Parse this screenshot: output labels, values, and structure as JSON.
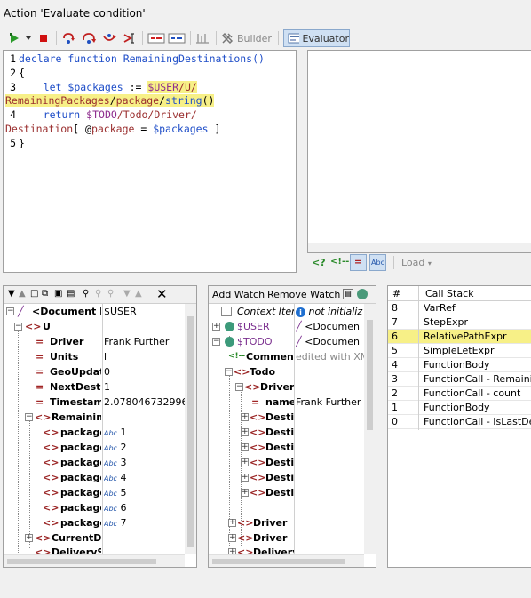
{
  "window": {
    "title": "Action 'Evaluate condition'"
  },
  "toolbar": {
    "builder_label": "Builder",
    "evaluator_label": "Evaluator",
    "icons": [
      "run-icon",
      "dropdown-arrow-icon",
      "stop-icon",
      "step-into-icon",
      "step-over-icon",
      "step-out-icon",
      "breakpoint-icon",
      "toggle-breakpoint-icon",
      "toggle-tracepoint-icon",
      "clear-icon",
      "builder-icon",
      "evaluator-icon"
    ]
  },
  "editor": {
    "lines": [
      {
        "num": "1",
        "text": "declare function RemainingDestinations()"
      },
      {
        "num": "2",
        "text": "{"
      },
      {
        "num": "3",
        "text": "    let $packages := $USER/U/"
      },
      {
        "num": "",
        "text": "RemainingPackages/package/string()"
      },
      {
        "num": "4",
        "text": "    return $TODO/Todo/Driver/"
      },
      {
        "num": "",
        "text": "Destination[ @package = $packages ]"
      },
      {
        "num": "5",
        "text": "}"
      }
    ]
  },
  "result_toolbar": {
    "load_label": "Load"
  },
  "xml_tree": {
    "rows": [
      {
        "label": "<Document Ro",
        "value": "$USER"
      },
      {
        "label": "U",
        "value": ""
      },
      {
        "label": "Driver",
        "value": "Frank Further"
      },
      {
        "label": "Units",
        "value": "l"
      },
      {
        "label": "GeoUpdate",
        "value": "0"
      },
      {
        "label": "NextDestin",
        "value": "1"
      },
      {
        "label": "Timestamp",
        "value": "2.0780467329966"
      },
      {
        "label": "Remaining",
        "value": ""
      },
      {
        "label": "package",
        "value": "1"
      },
      {
        "label": "package",
        "value": "2"
      },
      {
        "label": "package",
        "value": "3"
      },
      {
        "label": "package",
        "value": "4"
      },
      {
        "label": "package",
        "value": "5"
      },
      {
        "label": "package",
        "value": "6"
      },
      {
        "label": "package",
        "value": "7"
      },
      {
        "label": "CurrentDel",
        "value": ""
      },
      {
        "label": "DeliverySu",
        "value": ""
      }
    ]
  },
  "watch": {
    "add_label": "Add Watch",
    "remove_label": "Remove Watch",
    "rows": [
      {
        "label": "Context Item",
        "value": "not initializ"
      },
      {
        "label": "$USER",
        "value": "<Documen"
      },
      {
        "label": "$TODO",
        "value": "<Documen"
      },
      {
        "label": "Comment",
        "value": "edited with XM"
      },
      {
        "label": "Todo",
        "value": ""
      },
      {
        "label": "Driver",
        "value": ""
      },
      {
        "label": "name",
        "value": "Frank Further"
      },
      {
        "label": "Destin",
        "value": ""
      },
      {
        "label": "Destin",
        "value": ""
      },
      {
        "label": "Destin",
        "value": ""
      },
      {
        "label": "Destin",
        "value": ""
      },
      {
        "label": "Destin",
        "value": ""
      },
      {
        "label": "Destin",
        "value": ""
      },
      {
        "label": "Driver",
        "value": ""
      },
      {
        "label": "Driver",
        "value": ""
      },
      {
        "label": "Delivery",
        "value": ""
      }
    ]
  },
  "call_stack": {
    "col_num": "#",
    "col_name": "Call Stack",
    "rows": [
      {
        "num": "8",
        "name": "VarRef"
      },
      {
        "num": "7",
        "name": "StepExpr"
      },
      {
        "num": "6",
        "name": "RelativePathExpr"
      },
      {
        "num": "5",
        "name": "SimpleLetExpr"
      },
      {
        "num": "4",
        "name": "FunctionBody"
      },
      {
        "num": "3",
        "name": "FunctionCall - Remainin"
      },
      {
        "num": "2",
        "name": "FunctionCall - count"
      },
      {
        "num": "1",
        "name": "FunctionBody"
      },
      {
        "num": "0",
        "name": "FunctionCall - IsLastDes"
      }
    ]
  },
  "colors": {
    "highlight": "#f7f087",
    "accent": "#cfe0f3"
  }
}
